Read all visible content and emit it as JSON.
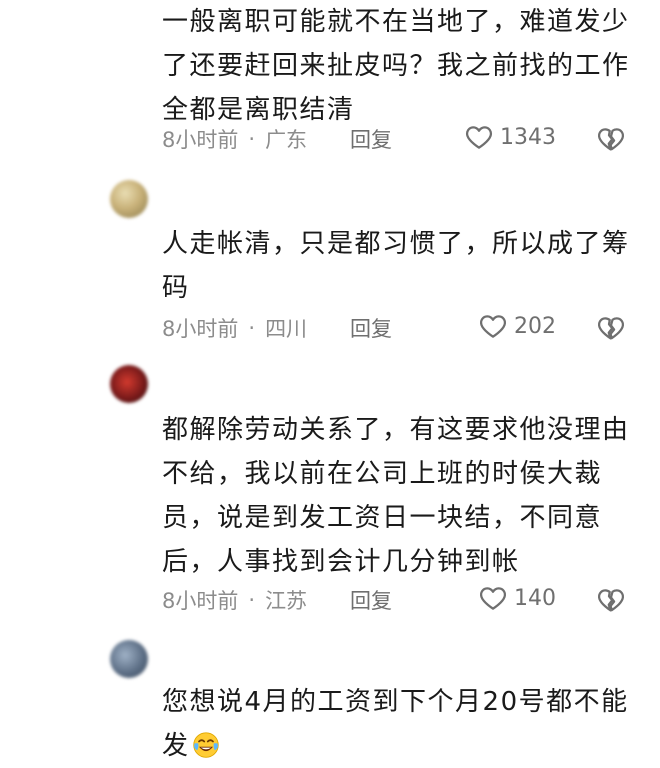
{
  "comments": [
    {
      "username": "",
      "body": "一般离职可能就不在当地了，难道发少\n了还要赶回来扯皮吗？我之前找的工作\n全都是离职结清",
      "time": "8小时前",
      "separator": "·",
      "location": "广东",
      "reply_label": "回复",
      "likes": "1343"
    },
    {
      "username": "",
      "body": "人走帐清，只是都习惯了，所以成了筹\n码",
      "time": "8小时前",
      "separator": "·",
      "location": "四川",
      "reply_label": "回复",
      "likes": "202"
    },
    {
      "username": "",
      "body": "都解除劳动关系了，有这要求他没理由\n不给，我以前在公司上班的时侯大裁\n员，说是到发工资日一块结，不同意\n后，人事找到会计几分钟到帐",
      "time": "8小时前",
      "separator": "·",
      "location": "江苏",
      "reply_label": "回复",
      "likes": "140"
    },
    {
      "username": "",
      "body": "您想说4月的工资到下个月20号都不能\n发",
      "emoji": "crying-laughing-emoji"
    }
  ],
  "icons": {
    "like": "heart-outline-icon",
    "dislike": "broken-heart-icon"
  },
  "colors": {
    "text": "#1a1a1a",
    "meta": "#8c8c8c",
    "icon": "#6f6f6f"
  }
}
